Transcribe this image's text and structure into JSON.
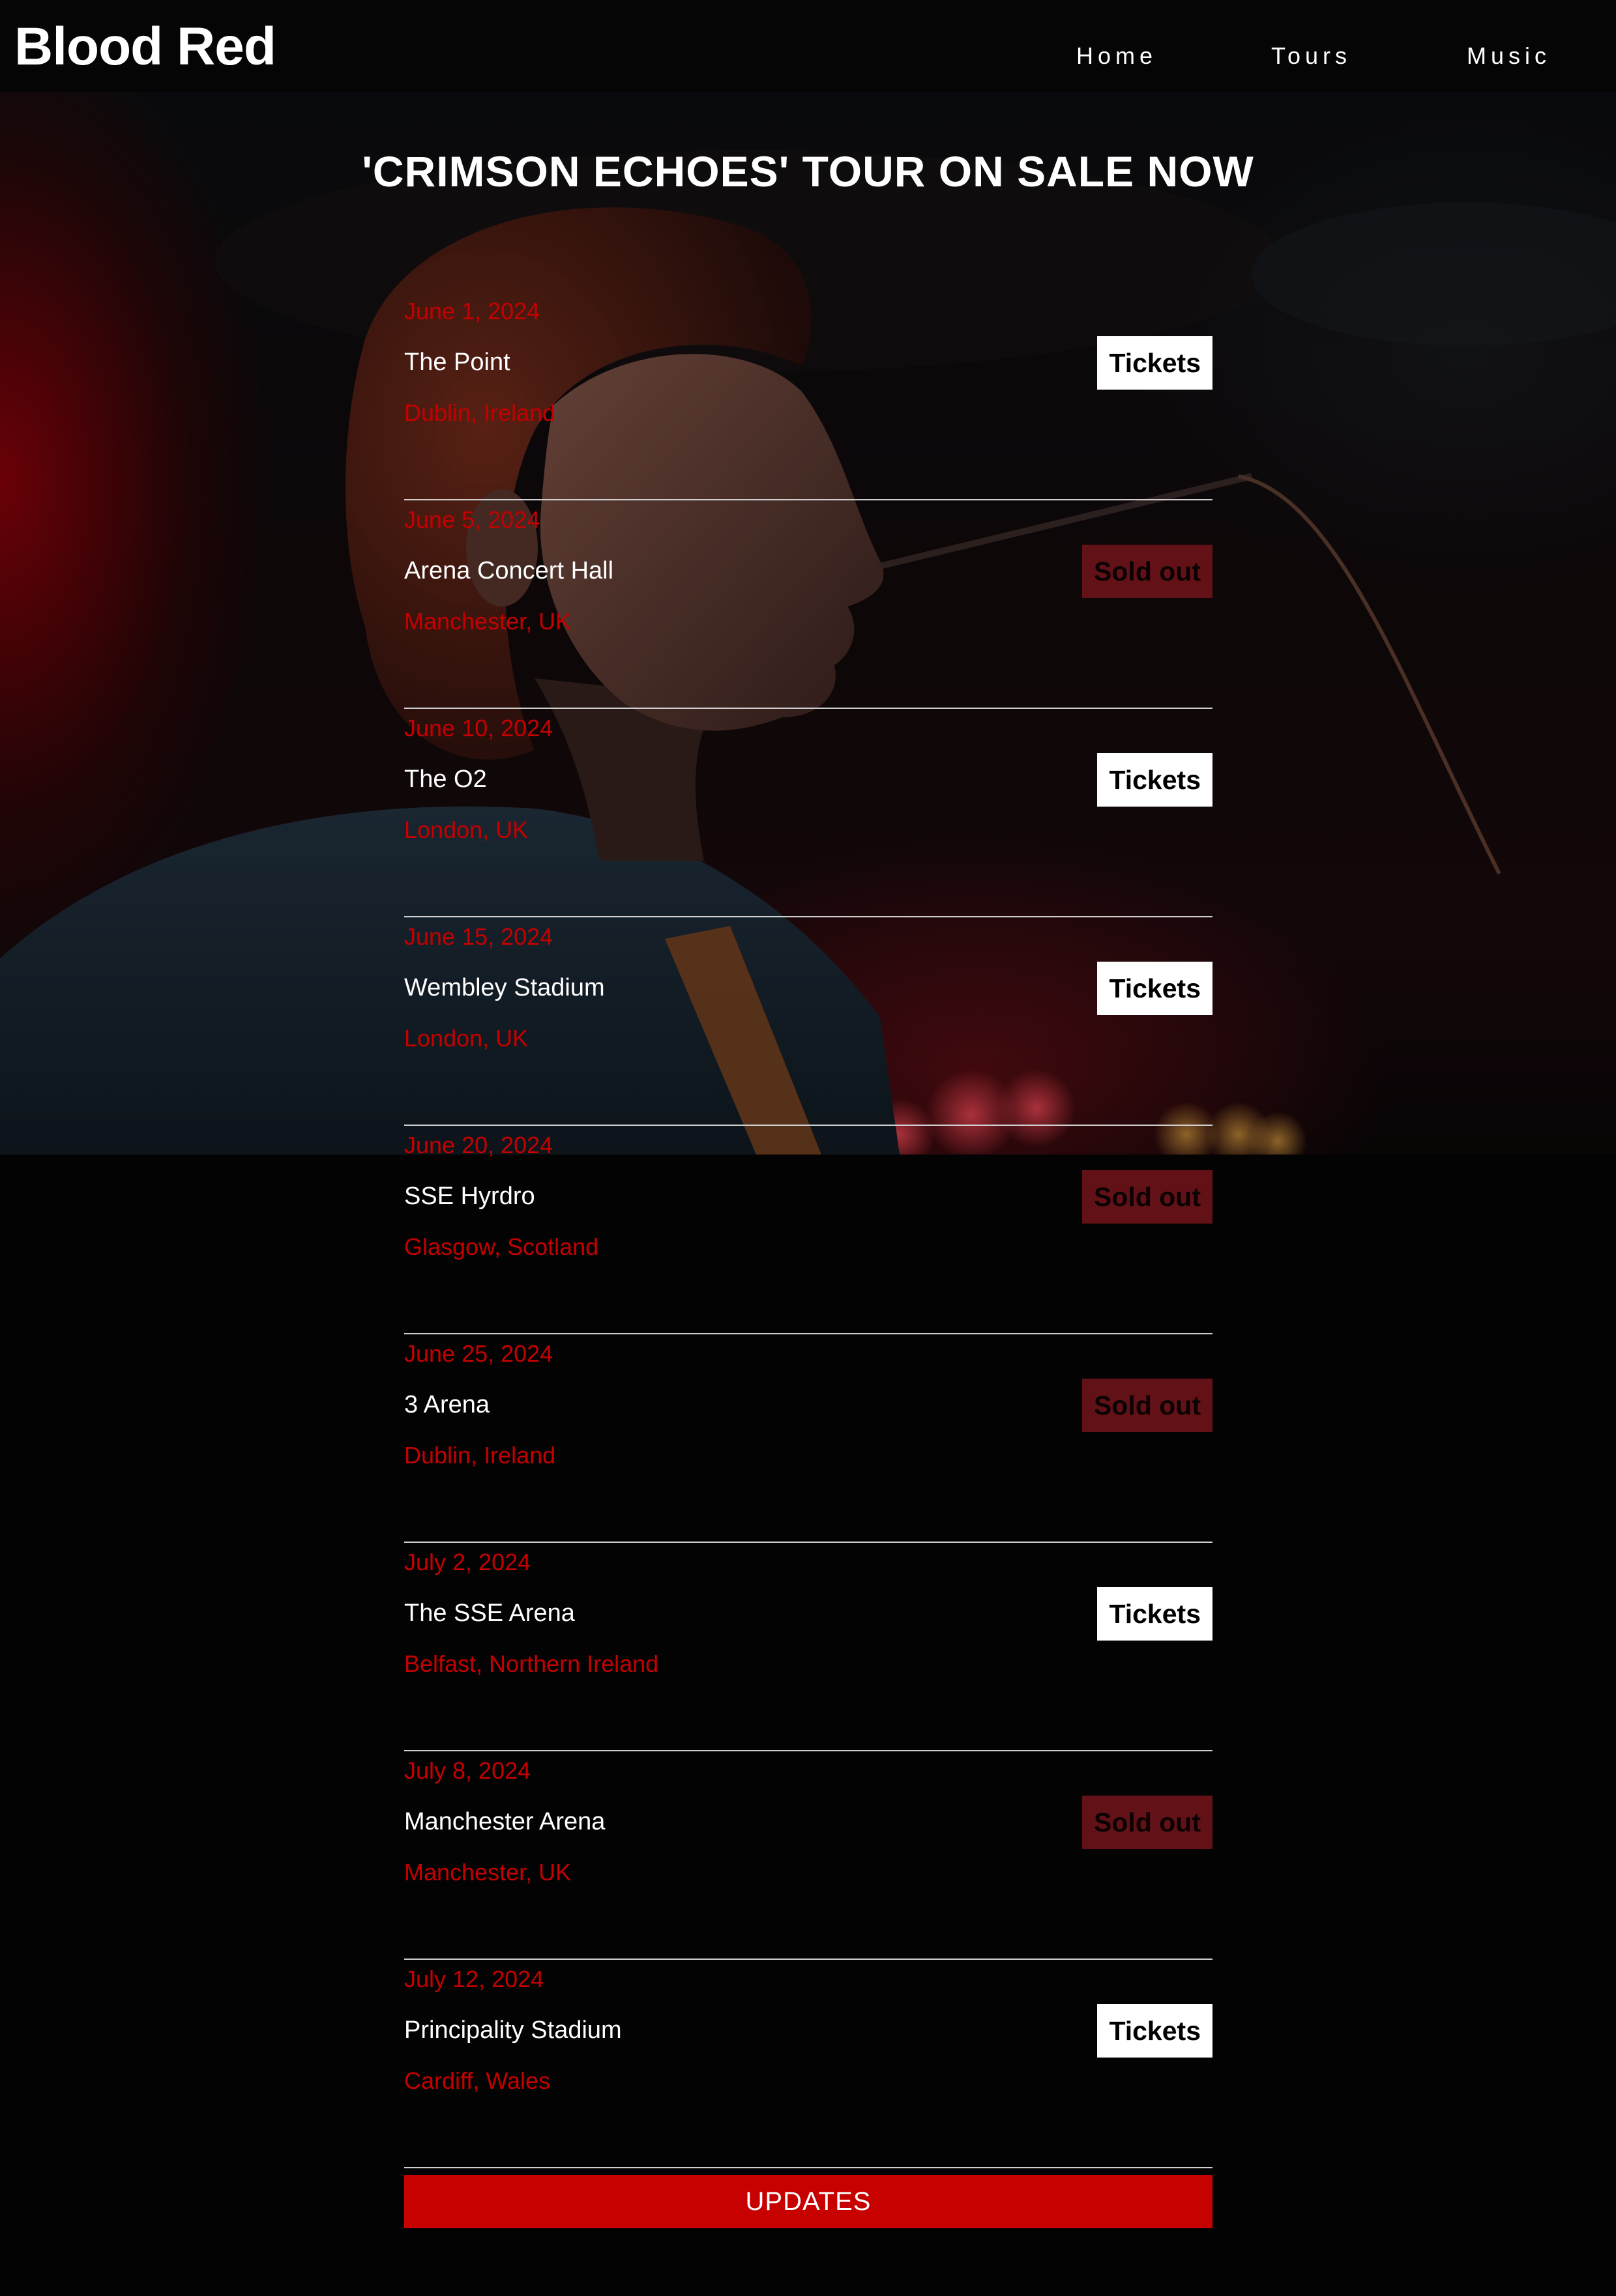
{
  "header": {
    "logo": "Blood Red",
    "nav": [
      "Home",
      "Tours",
      "Music"
    ]
  },
  "hero": {
    "image": "singer-portrait-photo",
    "title": "'CRIMSON ECHOES' TOUR ON SALE NOW"
  },
  "tours": [
    {
      "date": "June 1, 2024",
      "venue": "The Point",
      "location": "Dublin, Ireland",
      "button": "Tickets",
      "status": "available"
    },
    {
      "date": "June 5, 2024",
      "venue": "Arena Concert Hall",
      "location": "Manchester, UK",
      "button": "Sold out",
      "status": "soldout"
    },
    {
      "date": "June 10, 2024",
      "venue": "The O2",
      "location": "London, UK",
      "button": "Tickets",
      "status": "available"
    },
    {
      "date": "June 15, 2024",
      "venue": "Wembley Stadium",
      "location": "London, UK",
      "button": "Tickets",
      "status": "available"
    },
    {
      "date": "June 20, 2024",
      "venue": "SSE Hyrdro",
      "location": "Glasgow, Scotland",
      "button": "Sold out",
      "status": "soldout"
    },
    {
      "date": "June 25, 2024",
      "venue": "3 Arena",
      "location": "Dublin, Ireland",
      "button": "Sold out",
      "status": "soldout"
    },
    {
      "date": "July 2, 2024",
      "venue": "The SSE Arena",
      "location": "Belfast, Northern Ireland",
      "button": "Tickets",
      "status": "available"
    },
    {
      "date": "July 8, 2024",
      "venue": "Manchester Arena",
      "location": "Manchester, UK",
      "button": "Sold out",
      "status": "soldout"
    },
    {
      "date": "July 12, 2024",
      "venue": "Principality Stadium",
      "location": "Cardiff, Wales",
      "button": "Tickets",
      "status": "available"
    }
  ],
  "updates_button": "UPDATES",
  "colors": {
    "accent_red": "#c40000",
    "soldout_bg": "#621216",
    "background": "#030303",
    "text": "#ffffff"
  }
}
